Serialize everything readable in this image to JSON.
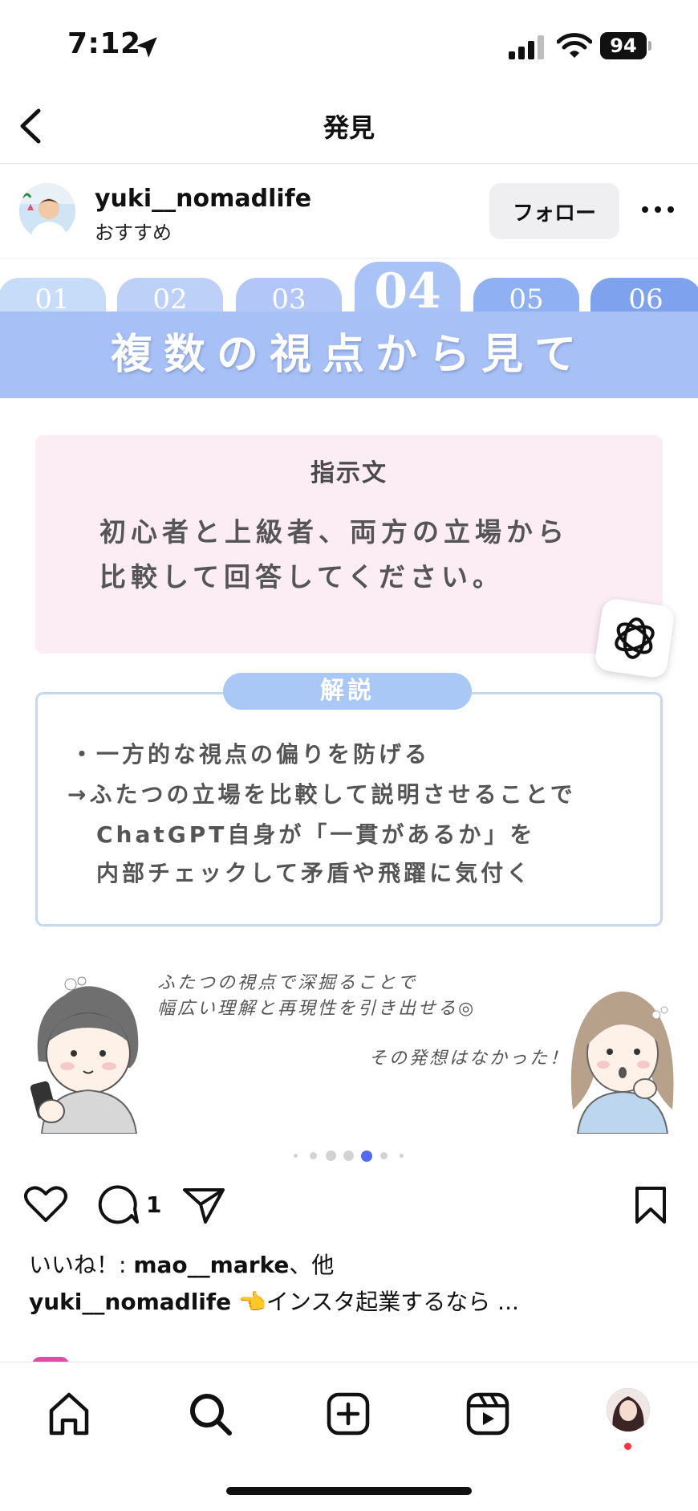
{
  "status_bar": {
    "time": "7:12",
    "battery": "94"
  },
  "header": {
    "title": "発見"
  },
  "post_author": {
    "username": "yuki__nomadlife",
    "subtitle": "おすすめ",
    "follow_label": "フォロー"
  },
  "slide": {
    "tabs": [
      "01",
      "02",
      "03",
      "04",
      "05",
      "06"
    ],
    "active_tab": "04",
    "banner": "複数の視点から見て",
    "prompt": {
      "title": "指示文",
      "line1": "初心者と上級者、両方の立場から",
      "line2": "比較して回答してください。"
    },
    "explanation": {
      "title": "解説",
      "lines": [
        "・一方的な視点の偏りを防げる",
        "→ふたつの立場を比較して説明させることで",
        "ChatGPT自身が「一貫があるか」を",
        "内部チェックして矛盾や飛躍に気付く"
      ]
    },
    "speech": {
      "left_line1": "ふたつの視点で深掘ることで",
      "left_line2": "幅広い理解と再現性を引き出せる◎",
      "right": "その発想はなかった！"
    }
  },
  "carousel": {
    "count": 7,
    "active_index": 4
  },
  "actions": {
    "comment_count": "1"
  },
  "likes": {
    "prefix": "いいね！: ",
    "user": "mao__marke",
    "suffix": "、他"
  },
  "caption": {
    "user": "yuki__nomadlife",
    "text": " 👈インスタ起業するなら ..."
  },
  "colors": {
    "slide_blue": "#a7c0f5",
    "prompt_pink": "#fcedf5",
    "dot_active": "#4f6cf0",
    "notify_red": "#ff3040"
  },
  "icons": [
    "location-arrow-icon",
    "signal-icon",
    "wifi-icon",
    "back-chevron-icon",
    "more-icon",
    "heart-icon",
    "comment-icon",
    "send-icon",
    "bookmark-icon",
    "home-icon",
    "search-icon",
    "create-icon",
    "reels-icon",
    "openai-logo-icon"
  ]
}
